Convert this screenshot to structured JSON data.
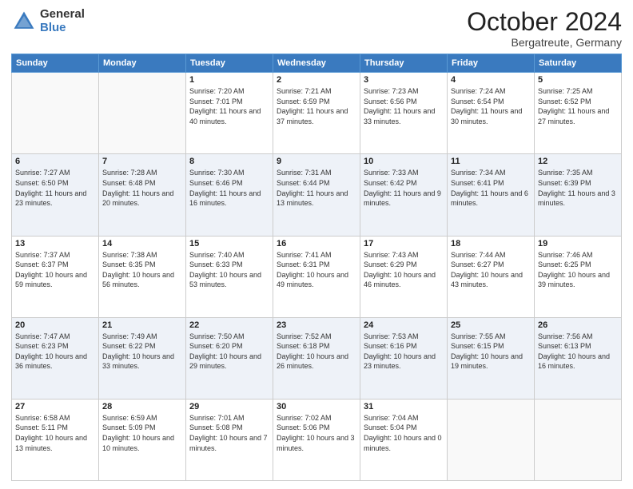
{
  "header": {
    "logo_general": "General",
    "logo_blue": "Blue",
    "month_title": "October 2024",
    "location": "Bergatreute, Germany"
  },
  "weekdays": [
    "Sunday",
    "Monday",
    "Tuesday",
    "Wednesday",
    "Thursday",
    "Friday",
    "Saturday"
  ],
  "weeks": [
    [
      {
        "day": "",
        "sunrise": "",
        "sunset": "",
        "daylight": ""
      },
      {
        "day": "",
        "sunrise": "",
        "sunset": "",
        "daylight": ""
      },
      {
        "day": "1",
        "sunrise": "Sunrise: 7:20 AM",
        "sunset": "Sunset: 7:01 PM",
        "daylight": "Daylight: 11 hours and 40 minutes."
      },
      {
        "day": "2",
        "sunrise": "Sunrise: 7:21 AM",
        "sunset": "Sunset: 6:59 PM",
        "daylight": "Daylight: 11 hours and 37 minutes."
      },
      {
        "day": "3",
        "sunrise": "Sunrise: 7:23 AM",
        "sunset": "Sunset: 6:56 PM",
        "daylight": "Daylight: 11 hours and 33 minutes."
      },
      {
        "day": "4",
        "sunrise": "Sunrise: 7:24 AM",
        "sunset": "Sunset: 6:54 PM",
        "daylight": "Daylight: 11 hours and 30 minutes."
      },
      {
        "day": "5",
        "sunrise": "Sunrise: 7:25 AM",
        "sunset": "Sunset: 6:52 PM",
        "daylight": "Daylight: 11 hours and 27 minutes."
      }
    ],
    [
      {
        "day": "6",
        "sunrise": "Sunrise: 7:27 AM",
        "sunset": "Sunset: 6:50 PM",
        "daylight": "Daylight: 11 hours and 23 minutes."
      },
      {
        "day": "7",
        "sunrise": "Sunrise: 7:28 AM",
        "sunset": "Sunset: 6:48 PM",
        "daylight": "Daylight: 11 hours and 20 minutes."
      },
      {
        "day": "8",
        "sunrise": "Sunrise: 7:30 AM",
        "sunset": "Sunset: 6:46 PM",
        "daylight": "Daylight: 11 hours and 16 minutes."
      },
      {
        "day": "9",
        "sunrise": "Sunrise: 7:31 AM",
        "sunset": "Sunset: 6:44 PM",
        "daylight": "Daylight: 11 hours and 13 minutes."
      },
      {
        "day": "10",
        "sunrise": "Sunrise: 7:33 AM",
        "sunset": "Sunset: 6:42 PM",
        "daylight": "Daylight: 11 hours and 9 minutes."
      },
      {
        "day": "11",
        "sunrise": "Sunrise: 7:34 AM",
        "sunset": "Sunset: 6:41 PM",
        "daylight": "Daylight: 11 hours and 6 minutes."
      },
      {
        "day": "12",
        "sunrise": "Sunrise: 7:35 AM",
        "sunset": "Sunset: 6:39 PM",
        "daylight": "Daylight: 11 hours and 3 minutes."
      }
    ],
    [
      {
        "day": "13",
        "sunrise": "Sunrise: 7:37 AM",
        "sunset": "Sunset: 6:37 PM",
        "daylight": "Daylight: 10 hours and 59 minutes."
      },
      {
        "day": "14",
        "sunrise": "Sunrise: 7:38 AM",
        "sunset": "Sunset: 6:35 PM",
        "daylight": "Daylight: 10 hours and 56 minutes."
      },
      {
        "day": "15",
        "sunrise": "Sunrise: 7:40 AM",
        "sunset": "Sunset: 6:33 PM",
        "daylight": "Daylight: 10 hours and 53 minutes."
      },
      {
        "day": "16",
        "sunrise": "Sunrise: 7:41 AM",
        "sunset": "Sunset: 6:31 PM",
        "daylight": "Daylight: 10 hours and 49 minutes."
      },
      {
        "day": "17",
        "sunrise": "Sunrise: 7:43 AM",
        "sunset": "Sunset: 6:29 PM",
        "daylight": "Daylight: 10 hours and 46 minutes."
      },
      {
        "day": "18",
        "sunrise": "Sunrise: 7:44 AM",
        "sunset": "Sunset: 6:27 PM",
        "daylight": "Daylight: 10 hours and 43 minutes."
      },
      {
        "day": "19",
        "sunrise": "Sunrise: 7:46 AM",
        "sunset": "Sunset: 6:25 PM",
        "daylight": "Daylight: 10 hours and 39 minutes."
      }
    ],
    [
      {
        "day": "20",
        "sunrise": "Sunrise: 7:47 AM",
        "sunset": "Sunset: 6:23 PM",
        "daylight": "Daylight: 10 hours and 36 minutes."
      },
      {
        "day": "21",
        "sunrise": "Sunrise: 7:49 AM",
        "sunset": "Sunset: 6:22 PM",
        "daylight": "Daylight: 10 hours and 33 minutes."
      },
      {
        "day": "22",
        "sunrise": "Sunrise: 7:50 AM",
        "sunset": "Sunset: 6:20 PM",
        "daylight": "Daylight: 10 hours and 29 minutes."
      },
      {
        "day": "23",
        "sunrise": "Sunrise: 7:52 AM",
        "sunset": "Sunset: 6:18 PM",
        "daylight": "Daylight: 10 hours and 26 minutes."
      },
      {
        "day": "24",
        "sunrise": "Sunrise: 7:53 AM",
        "sunset": "Sunset: 6:16 PM",
        "daylight": "Daylight: 10 hours and 23 minutes."
      },
      {
        "day": "25",
        "sunrise": "Sunrise: 7:55 AM",
        "sunset": "Sunset: 6:15 PM",
        "daylight": "Daylight: 10 hours and 19 minutes."
      },
      {
        "day": "26",
        "sunrise": "Sunrise: 7:56 AM",
        "sunset": "Sunset: 6:13 PM",
        "daylight": "Daylight: 10 hours and 16 minutes."
      }
    ],
    [
      {
        "day": "27",
        "sunrise": "Sunrise: 6:58 AM",
        "sunset": "Sunset: 5:11 PM",
        "daylight": "Daylight: 10 hours and 13 minutes."
      },
      {
        "day": "28",
        "sunrise": "Sunrise: 6:59 AM",
        "sunset": "Sunset: 5:09 PM",
        "daylight": "Daylight: 10 hours and 10 minutes."
      },
      {
        "day": "29",
        "sunrise": "Sunrise: 7:01 AM",
        "sunset": "Sunset: 5:08 PM",
        "daylight": "Daylight: 10 hours and 7 minutes."
      },
      {
        "day": "30",
        "sunrise": "Sunrise: 7:02 AM",
        "sunset": "Sunset: 5:06 PM",
        "daylight": "Daylight: 10 hours and 3 minutes."
      },
      {
        "day": "31",
        "sunrise": "Sunrise: 7:04 AM",
        "sunset": "Sunset: 5:04 PM",
        "daylight": "Daylight: 10 hours and 0 minutes."
      },
      {
        "day": "",
        "sunrise": "",
        "sunset": "",
        "daylight": ""
      },
      {
        "day": "",
        "sunrise": "",
        "sunset": "",
        "daylight": ""
      }
    ]
  ]
}
